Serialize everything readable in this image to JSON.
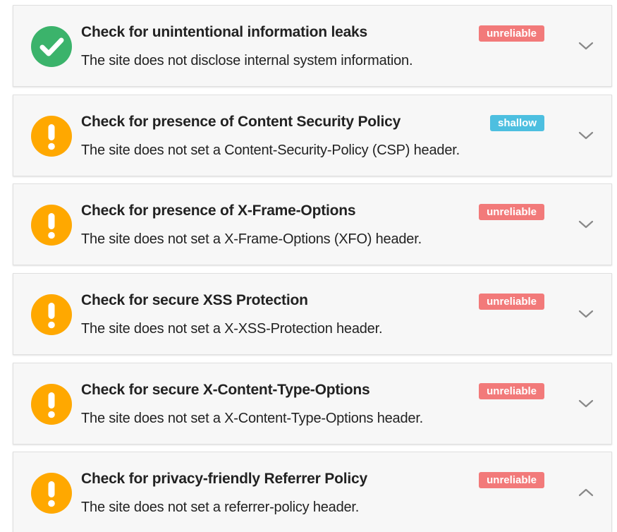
{
  "colors": {
    "pass": "#3bb36b",
    "warn": "#ffa800",
    "unreliable_badge": "#f27a7a",
    "shallow_badge": "#4dbfe0"
  },
  "checks": [
    {
      "status_icon": "check-circle-icon",
      "title": "Check for unintentional information leaks",
      "description": "The site does not disclose internal system information.",
      "badge": "unreliable",
      "expanded": false
    },
    {
      "status_icon": "warning-circle-icon",
      "title": "Check for presence of Content Security Policy",
      "description": "The site does not set a Content-Security-Policy (CSP) header.",
      "badge": "shallow",
      "expanded": false
    },
    {
      "status_icon": "warning-circle-icon",
      "title": "Check for presence of X-Frame-Options",
      "description": "The site does not set a X-Frame-Options (XFO) header.",
      "badge": "unreliable",
      "expanded": false
    },
    {
      "status_icon": "warning-circle-icon",
      "title": "Check for secure XSS Protection",
      "description": "The site does not set a X-XSS-Protection header.",
      "badge": "unreliable",
      "expanded": false
    },
    {
      "status_icon": "warning-circle-icon",
      "title": "Check for secure X-Content-Type-Options",
      "description": "The site does not set a X-Content-Type-Options header.",
      "badge": "unreliable",
      "expanded": false
    },
    {
      "status_icon": "warning-circle-icon",
      "title": "Check for privacy-friendly Referrer Policy",
      "description": "The site does not set a referrer-policy header.",
      "badge": "unreliable",
      "expanded": true
    }
  ]
}
